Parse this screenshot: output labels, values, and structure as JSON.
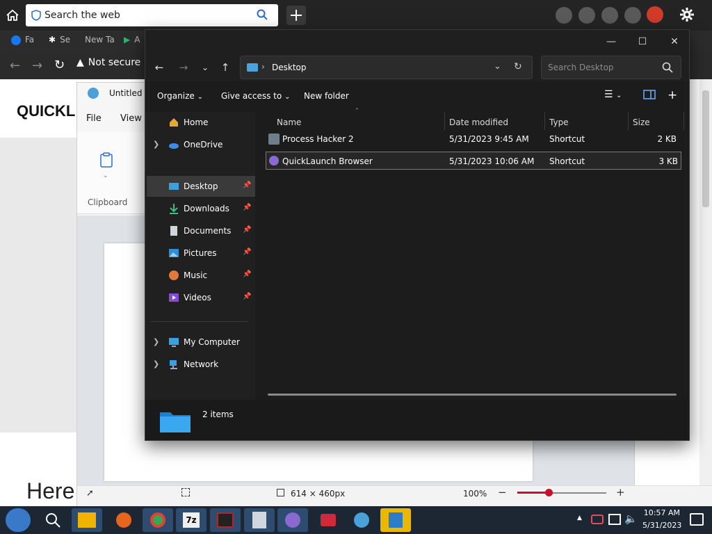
{
  "browser": {
    "search_placeholder": "Search the web",
    "tabs": [
      "Fa",
      "Se",
      "New Ta",
      "A"
    ],
    "security_text": "Not secure",
    "page_brand": "QUICKL",
    "page_heading": "Here"
  },
  "paint": {
    "title": "Untitled -",
    "menu_file": "File",
    "menu_view": "View",
    "clipboard_label": "Clipboard",
    "dimensions": "614 × 460px",
    "zoom": "100%",
    "zoom_level": 0.35
  },
  "explorer": {
    "address": "Desktop",
    "search_placeholder": "Search Desktop",
    "commands": {
      "organize": "Organize",
      "give_access": "Give access to",
      "new_folder": "New folder"
    },
    "nav": {
      "home": "Home",
      "onedrive": "OneDrive",
      "desktop": "Desktop",
      "downloads": "Downloads",
      "documents": "Documents",
      "pictures": "Pictures",
      "music": "Music",
      "videos": "Videos",
      "my_computer": "My Computer",
      "network": "Network"
    },
    "columns": {
      "name": "Name",
      "date": "Date modified",
      "type": "Type",
      "size": "Size"
    },
    "files": [
      {
        "name": "Process Hacker 2",
        "date": "5/31/2023 9:45 AM",
        "type": "Shortcut",
        "size": "2 KB"
      },
      {
        "name": "QuickLaunch Browser",
        "date": "5/31/2023 10:06 AM",
        "type": "Shortcut",
        "size": "3 KB"
      }
    ],
    "item_count": "2 items"
  },
  "taskbar": {
    "time": "10:57 AM",
    "date": "5/31/2023"
  },
  "colors": {
    "accent_red": "#c8102e",
    "explorer_bg": "#1c1c1c",
    "taskbar_bg": "#1d2733"
  }
}
